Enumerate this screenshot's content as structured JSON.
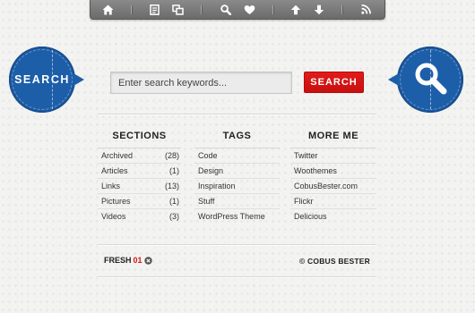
{
  "toolbar": {
    "icons": [
      "home-icon",
      "document-icon",
      "copy-icon",
      "search-icon",
      "heart-icon",
      "arrow-up-icon",
      "arrow-down-icon",
      "rss-icon"
    ]
  },
  "badges": {
    "left_label": "SEARCH",
    "right_icon": "magnifier-icon",
    "color": "#1d5ea9"
  },
  "search": {
    "placeholder": "Enter search keywords...",
    "button_label": "SEARCH",
    "button_color": "#d4151b"
  },
  "sections": {
    "title": "SECTIONS",
    "items": [
      {
        "label": "Archived",
        "count": "(28)"
      },
      {
        "label": "Articles",
        "count": "(1)"
      },
      {
        "label": "Links",
        "count": "(13)"
      },
      {
        "label": "Pictures",
        "count": "(1)"
      },
      {
        "label": "Videos",
        "count": "(3)"
      }
    ]
  },
  "tags": {
    "title": "TAGS",
    "items": [
      "Code",
      "Design",
      "Inspiration",
      "Stuff",
      "WordPress Theme"
    ]
  },
  "more_me": {
    "title": "MORE ME",
    "items": [
      "Twitter",
      "Woothemes",
      "CobusBester.com",
      "Flickr",
      "Delicious"
    ]
  },
  "footer": {
    "logo_main": "FRESH",
    "logo_accent": "01",
    "copyright": "© COBUS BESTER"
  }
}
